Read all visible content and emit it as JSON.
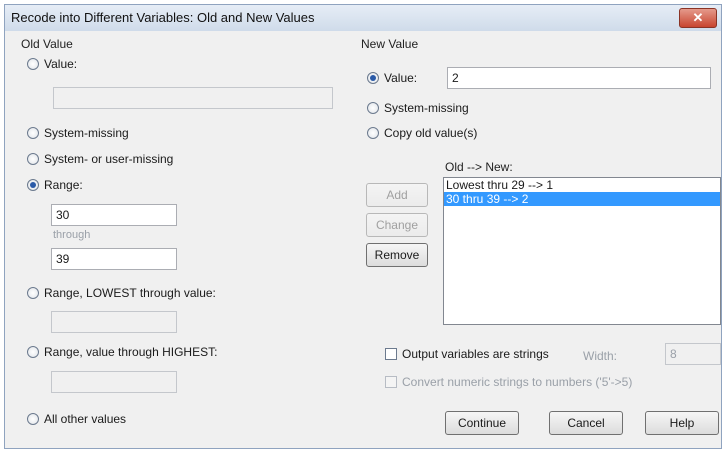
{
  "window": {
    "title": "Recode into Different Variables: Old and New Values",
    "close_glyph": "✕"
  },
  "old_value": {
    "group_label": "Old Value",
    "value_radio": "Value:",
    "value_input": "",
    "system_missing": "System-missing",
    "system_or_user_missing": "System- or user-missing",
    "range_radio": "Range:",
    "range_from": "30",
    "through_label": "through",
    "range_to": "39",
    "range_lowest": "Range, LOWEST through value:",
    "range_lowest_input": "",
    "range_highest": "Range, value through HIGHEST:",
    "range_highest_input": "",
    "all_other": "All other values",
    "selected": "range"
  },
  "new_value": {
    "group_label": "New Value",
    "value_radio": "Value:",
    "value_input": "2",
    "system_missing": "System-missing",
    "copy_old": "Copy old value(s)",
    "selected": "value"
  },
  "mapping": {
    "label": "Old --> New:",
    "items": [
      "Lowest thru 29 --> 1",
      "30 thru 39 --> 2"
    ],
    "selected_index": 1
  },
  "buttons": {
    "add": "Add",
    "change": "Change",
    "remove": "Remove",
    "continue": "Continue",
    "cancel": "Cancel",
    "help": "Help"
  },
  "options": {
    "output_strings": "Output variables are strings",
    "width_label": "Width:",
    "width_value": "8",
    "convert_numeric": "Convert numeric strings to numbers ('5'->5)"
  },
  "colors": {
    "accent": "#3399ff",
    "dialog_bg": "#f0f0f0",
    "close_red": "#c8452f"
  }
}
